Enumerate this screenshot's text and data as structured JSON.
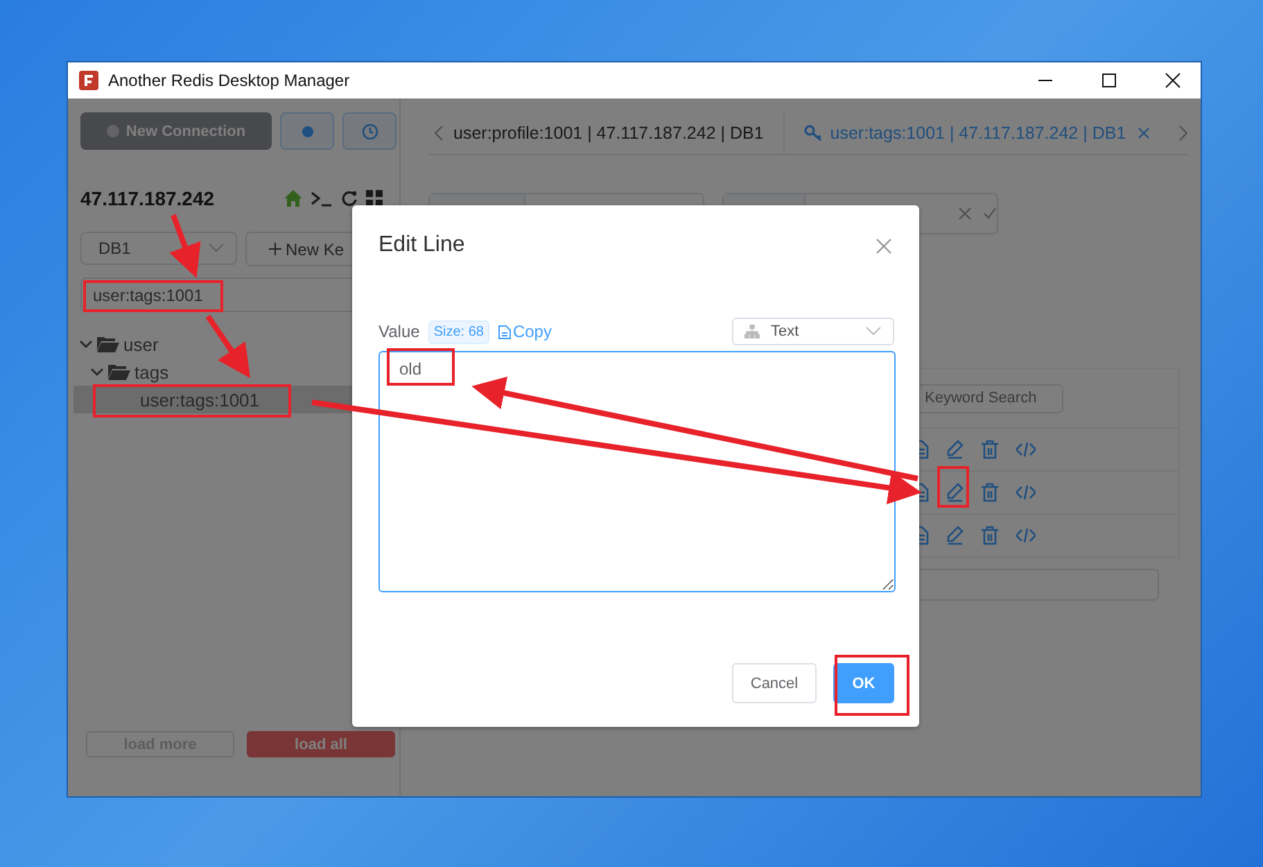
{
  "window": {
    "title": "Another Redis Desktop Manager"
  },
  "sidebar": {
    "new_connection": "New Connection",
    "host": "47.117.187.242",
    "db_select": "DB1",
    "new_key": "New Ke",
    "search_value": "user:tags:1001",
    "tree": [
      {
        "label": "user",
        "kind": "folder",
        "expanded": true,
        "selected": false,
        "children": [
          {
            "label": "tags",
            "kind": "folder",
            "expanded": true,
            "selected": false,
            "children": [
              {
                "label": "user:tags:1001",
                "kind": "key",
                "selected": true
              }
            ]
          }
        ]
      }
    ],
    "load_more": "load more",
    "load_all": "load all"
  },
  "tabs": [
    {
      "label": "user:profile:1001 | 47.117.187.242 | DB1",
      "selected": false
    },
    {
      "label": "user:tags:1001 | 47.117.187.242 | DB1",
      "selected": true
    }
  ],
  "table": {
    "search_placeholder": "Keyword Search"
  },
  "dialog": {
    "title": "Edit Line",
    "value_label": "Value",
    "size_tag": "Size: 68",
    "copy_link": "Copy",
    "format_select": "Text",
    "value": "old",
    "buttons": [
      {
        "label": "Cancel",
        "kind": "default"
      },
      {
        "label": "OK",
        "kind": "primary"
      }
    ]
  }
}
